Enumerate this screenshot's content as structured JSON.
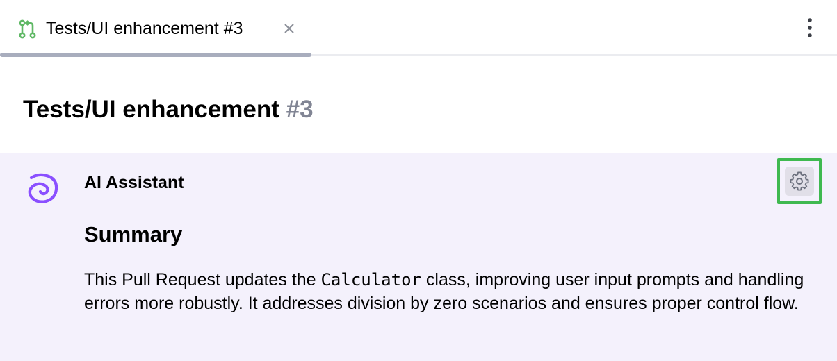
{
  "tab": {
    "label": "Tests/UI enhancement #3",
    "icon": "pull-request-icon",
    "close_icon": "close-icon"
  },
  "toolbar": {
    "more_icon": "more-vertical-icon"
  },
  "header": {
    "title": "Tests/UI enhancement",
    "number": "#3"
  },
  "assistant": {
    "name": "AI Assistant",
    "logo_icon": "ai-assistant-logo-icon",
    "settings_icon": "gear-icon",
    "summary_heading": "Summary",
    "summary_before": "This Pull Request updates the ",
    "summary_code": "Calculator",
    "summary_after": " class, improving user input prompts and handling errors more robustly. It addresses division by zero scenarios and ensures proper control flow."
  },
  "colors": {
    "accent_green": "#3fb950",
    "pr_icon_green": "#5fb865",
    "ai_purple": "#8a4fff",
    "panel_background": "#f4f1fc",
    "tab_underline": "#a8adbd",
    "muted_number": "#818594"
  }
}
